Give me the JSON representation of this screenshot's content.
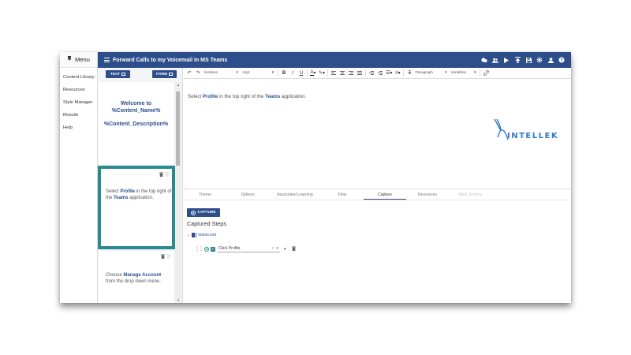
{
  "menu": {
    "title": "Menu",
    "items": [
      "Content Library",
      "Resources",
      "Style Manager",
      "Results",
      "Help"
    ]
  },
  "header": {
    "title": "Forward Calls to my Voicemail in MS Teams",
    "icons": [
      "chat-icon",
      "users-icon",
      "play-icon",
      "publish-icon",
      "save-icon",
      "settings-icon",
      "user-icon",
      "help-icon"
    ]
  },
  "slides": {
    "text_tab": "TEXT",
    "form_tab": "FORM",
    "card1": {
      "line1": "Welcome to",
      "line2": "%Content_Name%",
      "line3": "%Content_Description%"
    },
    "card2": {
      "pre": "Select ",
      "bold1": "Profile",
      "mid": " in the top right of the ",
      "bold2": "Teams",
      "post": " application."
    },
    "card3": {
      "pre": "Choose ",
      "bold1": "Manage Account",
      "post": " from the drop down menu."
    }
  },
  "toolbar": {
    "font": "Verdana",
    "size": "14pt",
    "block": "Paragraph",
    "variables": "Variables"
  },
  "editor": {
    "pre": "Select ",
    "bold1": "Profile",
    "mid": " in the top right of the ",
    "bold2": "Teams",
    "post": " application.",
    "logo_text": "INTELLEK"
  },
  "panel_tabs": [
    "Theme",
    "Options",
    "Associated Learning",
    "Flow",
    "Capture",
    "Resources",
    "Math Scoring"
  ],
  "active_tab": "Capture",
  "capture": {
    "button": "CAPTURE",
    "title": "Captured Steps",
    "app": "teams.exe",
    "step": "Click Profile."
  },
  "colors": {
    "primary": "#2d4e8a",
    "accent": "#2b8a8e",
    "logo": "#2f78c9"
  }
}
